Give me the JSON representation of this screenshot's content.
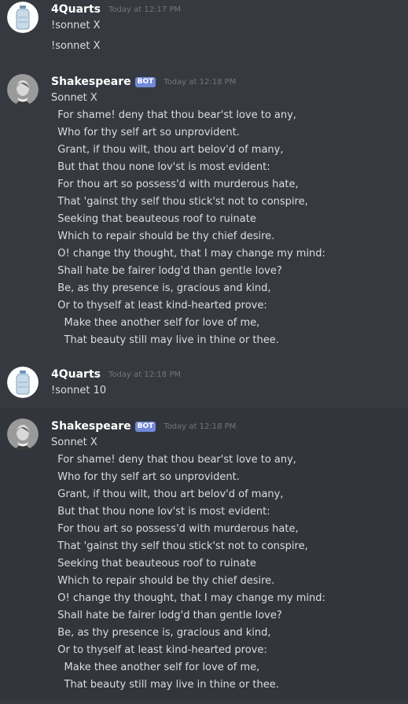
{
  "channel": {
    "messages": [
      {
        "author": "4Quarts",
        "bot": false,
        "timestamp": "Today at 12:17 PM",
        "avatar_icon": "water-jug-icon",
        "lines": [
          "!sonnet X",
          "!sonnet X"
        ]
      },
      {
        "author": "Shakespeare",
        "bot": true,
        "bot_tag": "BOT",
        "timestamp": "Today at 12:18 PM",
        "avatar_icon": "shakespeare-portrait-icon",
        "lines": [
          "Sonnet X",
          "  For shame! deny that thou bear'st love to any,",
          "  Who for thy self art so unprovident.",
          "  Grant, if thou wilt, thou art belov'd of many,",
          "  But that thou none lov'st is most evident:",
          "  For thou art so possess'd with murderous hate,",
          "  That 'gainst thy self thou stick'st not to conspire,",
          "  Seeking that beauteous roof to ruinate",
          "  Which to repair should be thy chief desire.",
          "  O! change thy thought, that I may change my mind:",
          "  Shall hate be fairer lodg'd than gentle love?",
          "  Be, as thy presence is, gracious and kind,",
          "  Or to thyself at least kind-hearted prove:",
          "    Make thee another self for love of me,",
          "    That beauty still may live in thine or thee."
        ]
      },
      {
        "author": "4Quarts",
        "bot": false,
        "timestamp": "Today at 12:18 PM",
        "avatar_icon": "water-jug-icon",
        "lines": [
          "!sonnet 10"
        ]
      },
      {
        "author": "Shakespeare",
        "bot": true,
        "bot_tag": "BOT",
        "timestamp": "Today at 12:18 PM",
        "avatar_icon": "shakespeare-portrait-icon",
        "lines": [
          "Sonnet X",
          "  For shame! deny that thou bear'st love to any,",
          "  Who for thy self art so unprovident.",
          "  Grant, if thou wilt, thou art belov'd of many,",
          "  But that thou none lov'st is most evident:",
          "  For thou art so possess'd with murderous hate,",
          "  That 'gainst thy self thou stick'st not to conspire,",
          "  Seeking that beauteous roof to ruinate",
          "  Which to repair should be thy chief desire.",
          "  O! change thy thought, that I may change my mind:",
          "  Shall hate be fairer lodg'd than gentle love?",
          "  Be, as thy presence is, gracious and kind,",
          "  Or to thyself at least kind-hearted prove:",
          "    Make thee another self for love of me,",
          "    That beauty still may live in thine or thee."
        ]
      }
    ]
  },
  "colors": {
    "background": "#36393f",
    "hover_background": "#32353b",
    "username": "#ffffff",
    "text": "#dcddde",
    "timestamp": "#72767d",
    "bot_tag": "#7289da"
  }
}
